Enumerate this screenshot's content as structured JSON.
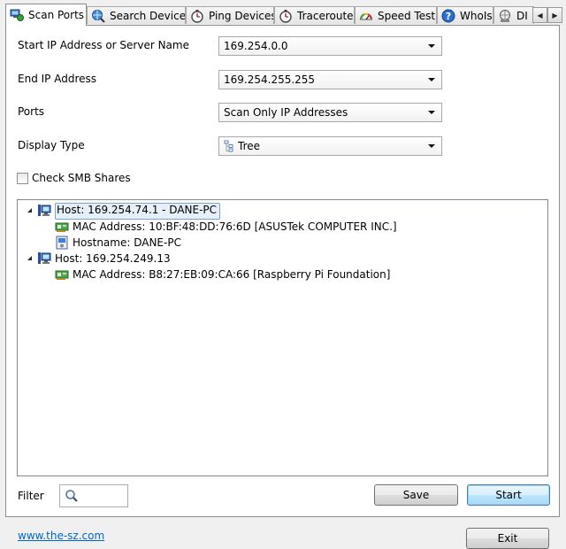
{
  "tabs": [
    {
      "label": "Scan Ports",
      "icon": "network-scan-icon",
      "active": true
    },
    {
      "label": "Search Devices",
      "icon": "globe-search-icon",
      "active": false
    },
    {
      "label": "Ping Devices",
      "icon": "stopwatch-icon",
      "active": false
    },
    {
      "label": "Traceroute",
      "icon": "stopwatch-icon",
      "active": false
    },
    {
      "label": "Speed Test",
      "icon": "speedometer-icon",
      "active": false
    },
    {
      "label": "WhoIs",
      "icon": "help-icon",
      "active": false
    },
    {
      "label": "DI",
      "icon": "dns-icon",
      "active": false
    }
  ],
  "scroll_buttons": {
    "left": "◀",
    "right": "▶"
  },
  "form": {
    "start_ip_label": "Start IP Address or Server Name",
    "start_ip_value": "169.254.0.0",
    "end_ip_label": "End IP Address",
    "end_ip_value": "169.254.255.255",
    "ports_label": "Ports",
    "ports_value": "Scan Only IP Addresses",
    "display_type_label": "Display Type",
    "display_type_value": "Tree",
    "check_smb_label": "Check SMB Shares",
    "check_smb_checked": false
  },
  "tree": {
    "hosts": [
      {
        "label": "Host: 169.254.74.1 - DANE-PC",
        "selected": true,
        "expanded": true,
        "children": [
          {
            "label": "MAC Address: 10:BF:48:DD:76:6D [ASUSTek COMPUTER INC.]",
            "icon": "network-card-icon"
          },
          {
            "label": "Hostname: DANE-PC",
            "icon": "computer-name-icon"
          }
        ]
      },
      {
        "label": "Host: 169.254.249.13",
        "selected": false,
        "expanded": true,
        "children": [
          {
            "label": "MAC Address: B8:27:EB:09:CA:66 [Raspberry Pi Foundation]",
            "icon": "network-card-icon"
          }
        ]
      }
    ]
  },
  "filter": {
    "label": "Filter",
    "value": ""
  },
  "buttons": {
    "save": "Save",
    "start": "Start",
    "exit": "Exit"
  },
  "footer": {
    "link_text": "www.the-sz.com"
  },
  "colors": {
    "link": "#0066cc",
    "selection_bg": "#e6f0fa",
    "selection_border": "#7da2ce"
  }
}
